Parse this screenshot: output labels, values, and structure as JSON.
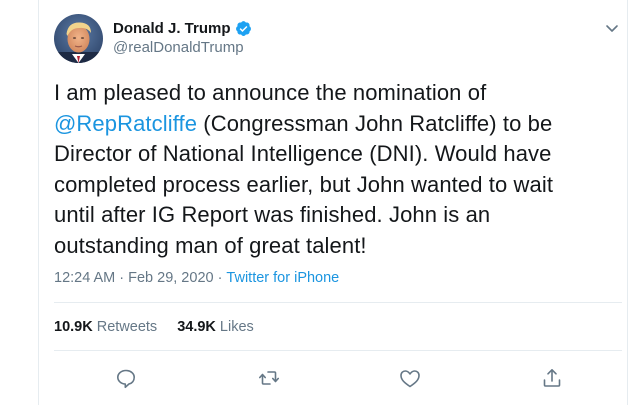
{
  "author": {
    "display_name": "Donald J. Trump",
    "handle": "@realDonaldTrump",
    "verified": true
  },
  "tweet": {
    "line1": "I am pleased to announce the nomination of",
    "mention": "@RepRatcliffe",
    "line2_rest": " (Congressman John Ratcliffe) to be",
    "line3": "Director of National Intelligence (DNI). Would have",
    "line4": "completed process earlier, but John wanted to wait",
    "line5": "until after IG Report was finished. John is an",
    "line6": "outstanding man of great talent!"
  },
  "meta": {
    "time": "12:24 AM",
    "separator": "·",
    "date": "Feb 29, 2020",
    "separator2": "·",
    "source": "Twitter for iPhone"
  },
  "stats": {
    "retweets_count": "10.9K",
    "retweets_label": "Retweets",
    "likes_count": "34.9K",
    "likes_label": "Likes"
  },
  "actions": [
    "reply-icon",
    "retweet-icon",
    "like-icon",
    "share-icon"
  ],
  "colors": {
    "link": "#1b95e0",
    "secondary_text": "#657786",
    "primary_text": "#14171a",
    "verified_badge": "#1da1f2",
    "divider": "#e6ecf0"
  }
}
